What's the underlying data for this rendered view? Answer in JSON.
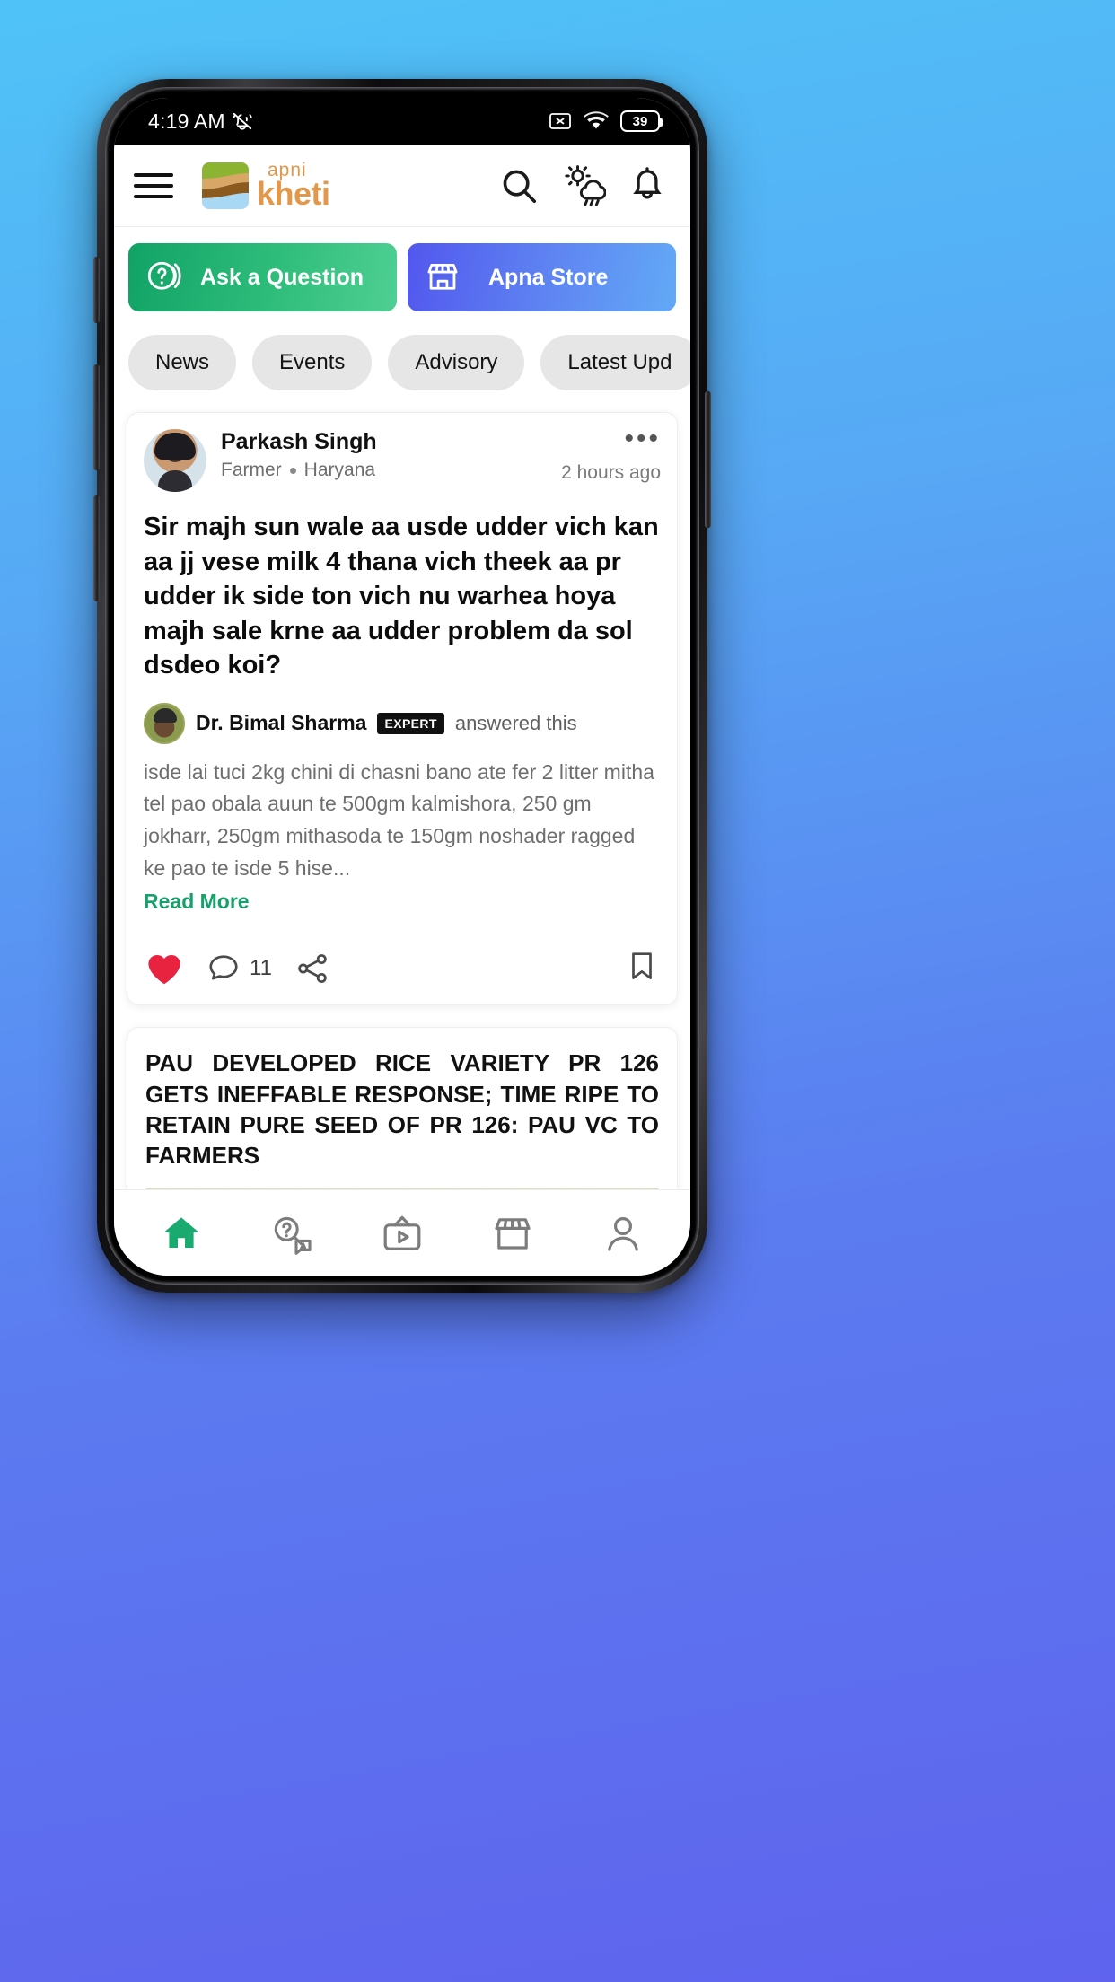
{
  "status_bar": {
    "time": "4:19 AM",
    "mute_icon": "bell-muted-icon",
    "cast_icon": "screen-cast-off-icon",
    "wifi_icon": "wifi-icon",
    "battery_level": "39"
  },
  "header": {
    "menu_icon": "hamburger-menu-icon",
    "logo_mark": "apni-kheti-logo-icon",
    "logo_top": "apni",
    "logo_bottom": "kheti",
    "search_icon": "search-icon",
    "weather_icon": "weather-rain-sun-icon",
    "notification_icon": "bell-icon"
  },
  "actions": [
    {
      "label": "Ask a Question",
      "icon": "question-chat-icon",
      "color": "#2fbd7b"
    },
    {
      "label": "Apna Store",
      "icon": "store-icon",
      "color": "#5f86f2"
    }
  ],
  "chips": [
    {
      "label": "News"
    },
    {
      "label": "Events"
    },
    {
      "label": "Advisory"
    },
    {
      "label": "Latest Upd"
    }
  ],
  "post": {
    "author": "Parkash Singh",
    "role": "Farmer",
    "location": "Haryana",
    "time": "2 hours ago",
    "more_icon": "more-options-icon",
    "avatar": "user-avatar",
    "question": "Sir majh sun wale aa usde udder vich kan aa jj vese milk 4 thana vich theek aa pr udder ik side ton vich nu warhea hoya majh sale krne aa udder problem da sol dsdeo koi?",
    "expert_name": "Dr. Bimal Sharma",
    "expert_badge": "EXPERT",
    "answered_label": "answered this",
    "answer_text": "isde lai tuci 2kg chini di chasni bano ate fer 2 litter mitha tel pao obala auun te 500gm kalmishora, 250 gm jokharr, 250gm mithasoda te 150gm noshader ragged ke pao te isde 5 hise...",
    "read_more": "Read More",
    "like_icon": "heart-filled-icon",
    "comment_icon": "comment-icon",
    "comment_count": "11",
    "share_icon": "share-icon",
    "bookmark_icon": "bookmark-icon"
  },
  "news": {
    "title": "PAU DEVELOPED RICE VARIETY PR 126 GETS INEFFABLE RESPONSE; TIME RIPE TO RETAIN PURE SEED OF PR 126: PAU VC TO FARMERS",
    "image": "rice-field-photo"
  },
  "bottom_nav": [
    {
      "icon": "home-icon",
      "active": true
    },
    {
      "icon": "qa-search-icon",
      "active": false
    },
    {
      "icon": "video-icon",
      "active": false
    },
    {
      "icon": "store-icon",
      "active": false
    },
    {
      "icon": "profile-icon",
      "active": false
    }
  ],
  "colors": {
    "brand_green": "#17a06a",
    "brand_orange": "#e2974a",
    "store_blue": "#5f86f2",
    "like_red": "#e8233f"
  }
}
